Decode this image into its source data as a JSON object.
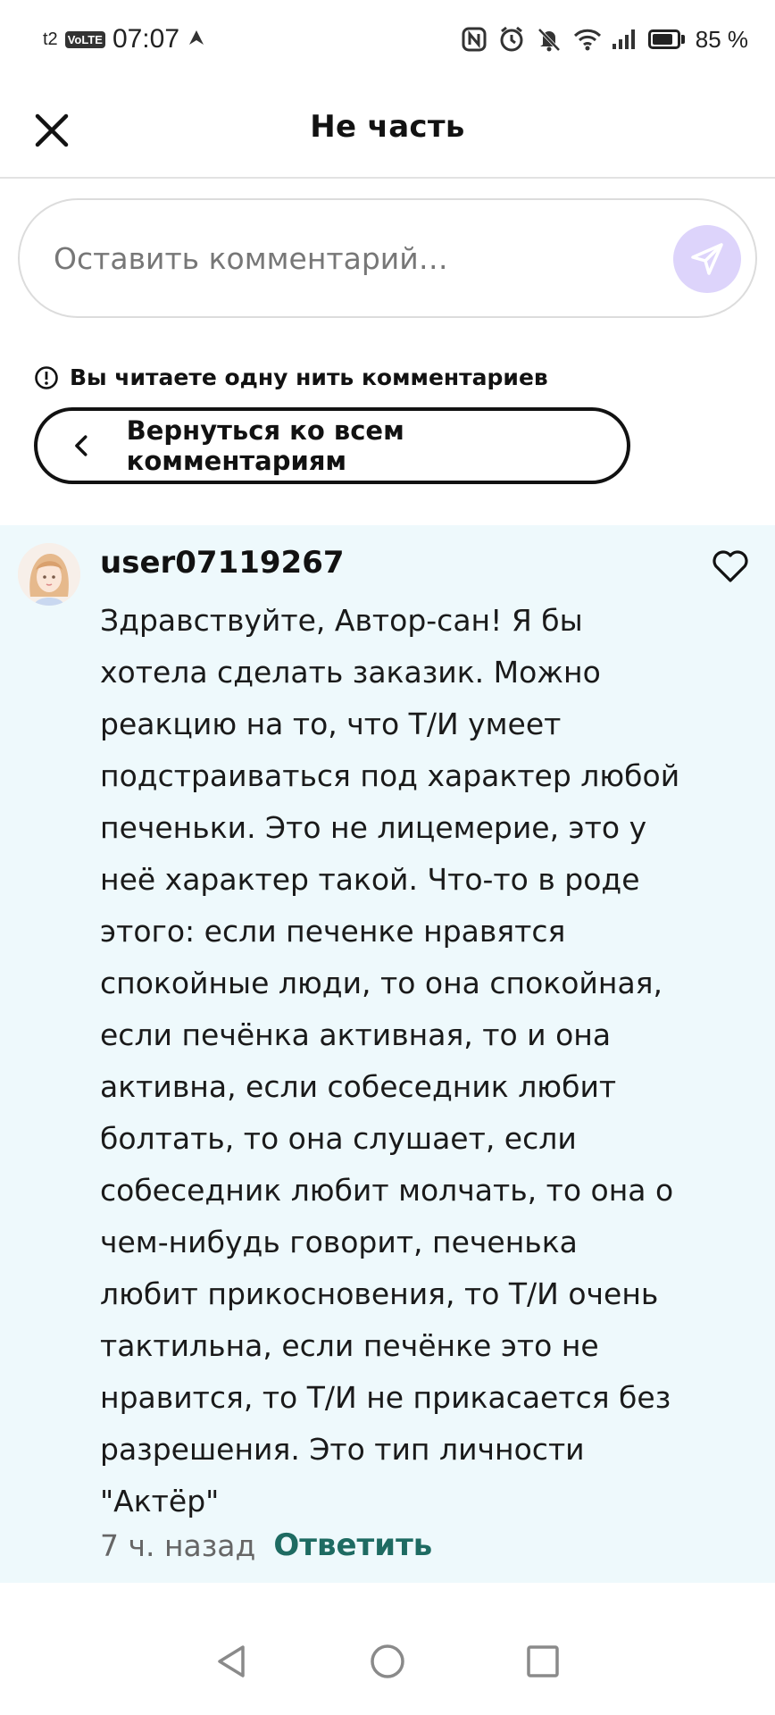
{
  "status_bar": {
    "carrier": "t2",
    "network_badge": "VoLTE",
    "time": "07:07",
    "battery_text": "85 %",
    "battery_level": 0.85,
    "icons": [
      "nfc-icon",
      "alarm-icon",
      "bell-muted-icon",
      "wifi-icon",
      "signal-icon",
      "battery-icon"
    ]
  },
  "header": {
    "title": "Не часть",
    "close_icon": "close-icon"
  },
  "comment_input": {
    "placeholder": "Оставить комментарий…",
    "value": "",
    "send_icon": "send-icon",
    "send_color": "#ddd4fb"
  },
  "thread": {
    "notice": "Вы читаете одну нить комментариев",
    "back_label": "Вернуться ко всем комментариям"
  },
  "comment": {
    "username": "user07119267",
    "text": "Здравствуйте, Автор-сан! Я бы\nхотела сделать заказик. Можно\nреакцию на то, что  Т/И умеет\nподстраиваться под характер любой\nпеченьки. Это не лицемерие, это у\nнеё характер такой. Что-то в роде\nэтого: если печенке нравятся\nспокойные люди, то она спокойная,\nесли печёнка активная, то и она\nактивна, если собеседник любит\nболтать, то она слушает, если\nсобеседник любит молчать, то она о\nчем-нибудь говорит, печенька\nлюбит прикосновения, то Т/И очень\nтактильна, если печёнке это не\nнравится, то Т/И не прикасается без\nразрешения. Это тип личности\n\"Актёр\"",
    "time_ago": "7 ч. назад",
    "reply_label": "Ответить",
    "card_color": "#eef9fc",
    "reply_color": "#1e6b62"
  },
  "nav_bar": {
    "buttons": [
      "back-icon",
      "home-icon",
      "recents-icon"
    ]
  }
}
